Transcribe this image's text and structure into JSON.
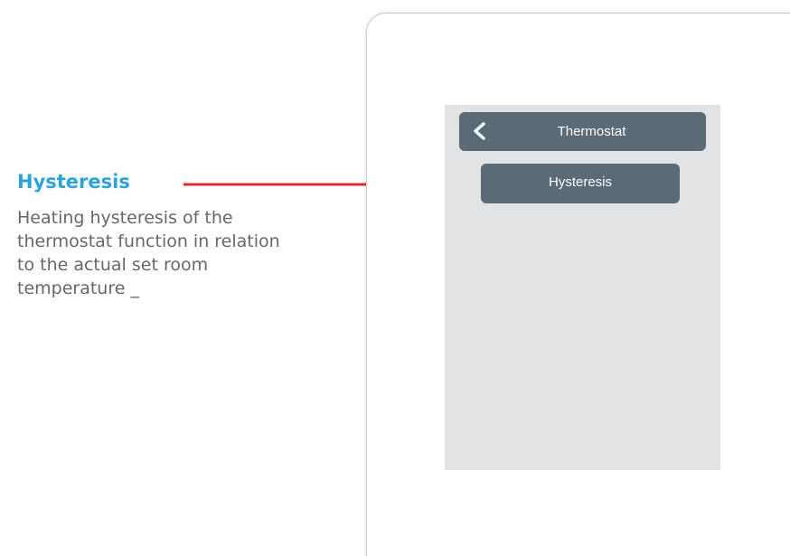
{
  "caption": {
    "title": "Hysteresis",
    "description": "Heating hysteresis of the thermostat function in relation to the actual set room temperature _"
  },
  "colors": {
    "accent": "#2aa4dc",
    "arrow": "#e8233a",
    "bar": "#5b6a77",
    "screen": "#e2e3e5"
  },
  "screen": {
    "header": {
      "back_icon": "chevron-left-icon",
      "title": "Thermostat"
    },
    "menu": {
      "items": [
        {
          "label": "Hysteresis"
        }
      ]
    }
  }
}
